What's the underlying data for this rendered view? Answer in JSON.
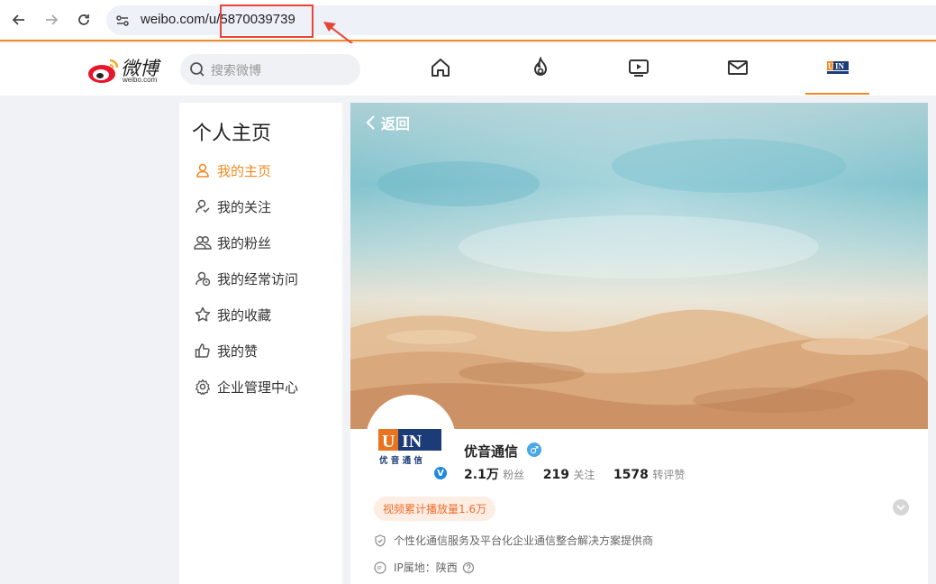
{
  "browser": {
    "url": "weibo.com/u/5870039739",
    "annotation_color": "#e8443a"
  },
  "header": {
    "logo_text": "微博",
    "logo_sub": "weibo.com",
    "search_placeholder": "搜索微博",
    "nav_icons": [
      "home-icon",
      "hot-icon",
      "video-icon",
      "mail-icon",
      "profile-avatar"
    ],
    "accent": "#f08a24"
  },
  "sidebar": {
    "title": "个人主页",
    "items": [
      {
        "label": "我的主页",
        "icon": "user-icon",
        "active": true
      },
      {
        "label": "我的关注",
        "icon": "user-check-icon",
        "active": false
      },
      {
        "label": "我的粉丝",
        "icon": "users-icon",
        "active": false
      },
      {
        "label": "我的经常访问",
        "icon": "user-clock-icon",
        "active": false
      },
      {
        "label": "我的收藏",
        "icon": "star-icon",
        "active": false
      },
      {
        "label": "我的赞",
        "icon": "thumbs-up-icon",
        "active": false
      },
      {
        "label": "企业管理中心",
        "icon": "gear-icon",
        "active": false
      }
    ]
  },
  "profile": {
    "back_label": "返回",
    "logo_letters": "UIN",
    "logo_chinese": "优 音 通 信",
    "name": "优音通信",
    "gender_symbol": "♂",
    "verified_symbol": "V",
    "followers_count": "2.1万",
    "followers_label": "粉丝",
    "following_count": "219",
    "following_label": "关注",
    "reposts_count": "1578",
    "reposts_label": "转评赞",
    "video_tag": "视频累计播放量1.6万",
    "description": "个性化通信服务及平台化企业通信整合解决方案提供商",
    "ip_label": "IP属地：陕西"
  }
}
